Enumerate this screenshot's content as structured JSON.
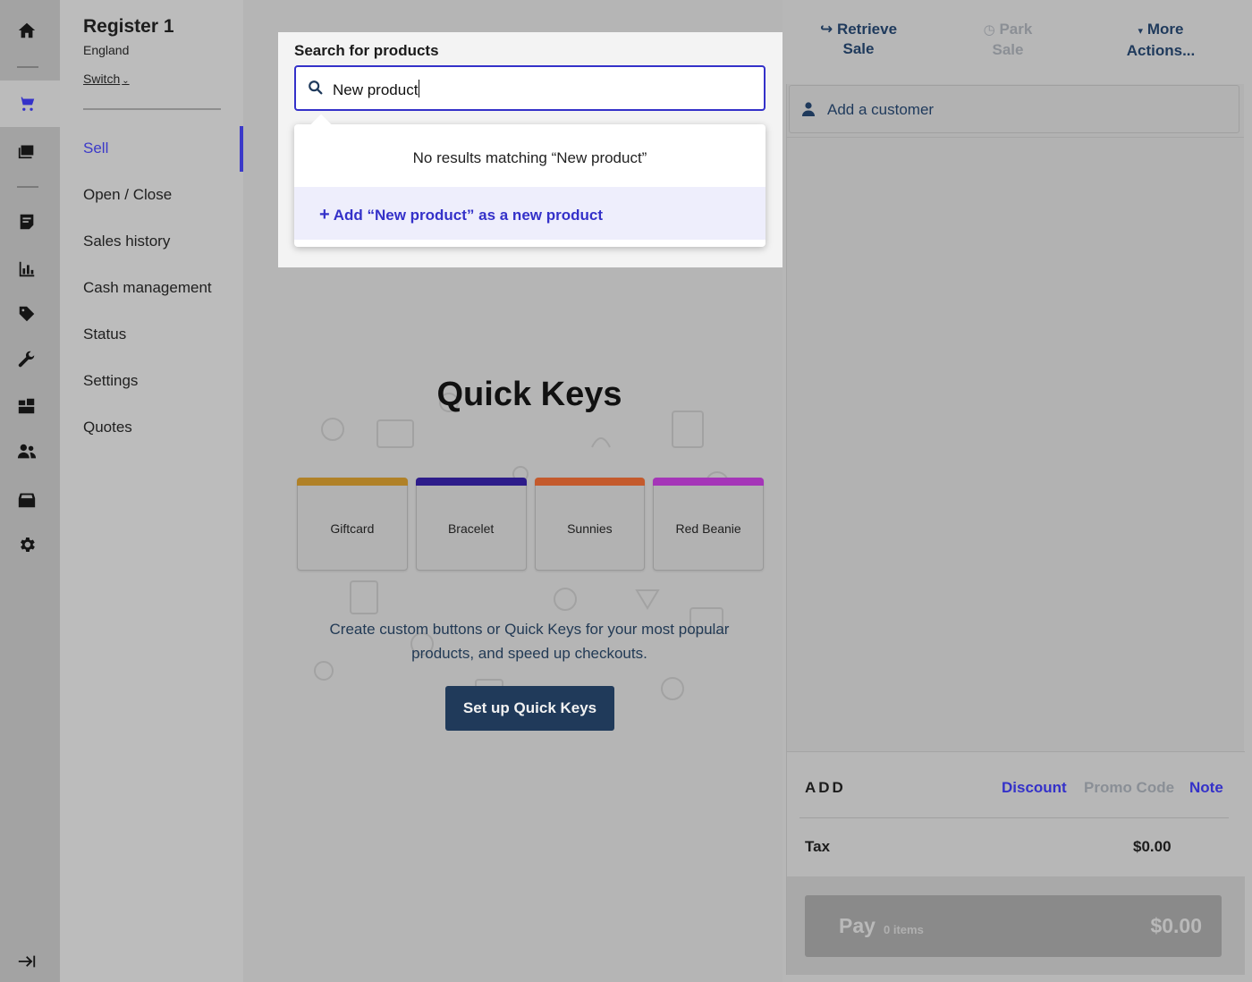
{
  "register": {
    "name": "Register 1",
    "location": "England",
    "switch_label": "Switch"
  },
  "subnav": {
    "items": [
      {
        "label": "Sell",
        "active": true
      },
      {
        "label": "Open / Close"
      },
      {
        "label": "Sales history"
      },
      {
        "label": "Cash management"
      },
      {
        "label": "Status"
      },
      {
        "label": "Settings"
      },
      {
        "label": "Quotes"
      }
    ]
  },
  "rail": {
    "icons": [
      "home-icon",
      "cart-icon",
      "catalog-icon",
      "sales-ledger-icon",
      "reports-icon",
      "tag-icon",
      "wrench-icon",
      "inventory-icon",
      "customers-icon",
      "cash-drawer-icon",
      "gear-icon",
      "expand-sidebar-icon"
    ]
  },
  "search": {
    "label": "Search for products",
    "value": "New product",
    "no_results": "No results matching “New product”",
    "add_new": "Add “New product” as a new product"
  },
  "quick_keys": {
    "title": "Quick Keys",
    "tiles": [
      {
        "label": "Giftcard",
        "color": "#b08127"
      },
      {
        "label": "Bracelet",
        "color": "#2d1c8a"
      },
      {
        "label": "Sunnies",
        "color": "#c45a2c"
      },
      {
        "label": "Red Beanie",
        "color": "#a535b8"
      }
    ],
    "description": "Create custom buttons or Quick Keys for your most popular products, and speed up checkouts.",
    "setup_button": "Set up Quick Keys"
  },
  "actions": {
    "retrieve_sale": "Retrieve Sale",
    "park_sale": "Park Sale",
    "more_actions": "More Actions..."
  },
  "cart": {
    "add_customer": "Add a customer",
    "add_label": "ADD",
    "discount": "Discount",
    "promo_code": "Promo Code",
    "note": "Note",
    "tax_label": "Tax",
    "tax_value": "$0.00",
    "pay_label": "Pay",
    "pay_items": "0 items",
    "pay_total": "$0.00"
  },
  "colors": {
    "accent": "#3431c9",
    "navy": "#203a5a"
  }
}
